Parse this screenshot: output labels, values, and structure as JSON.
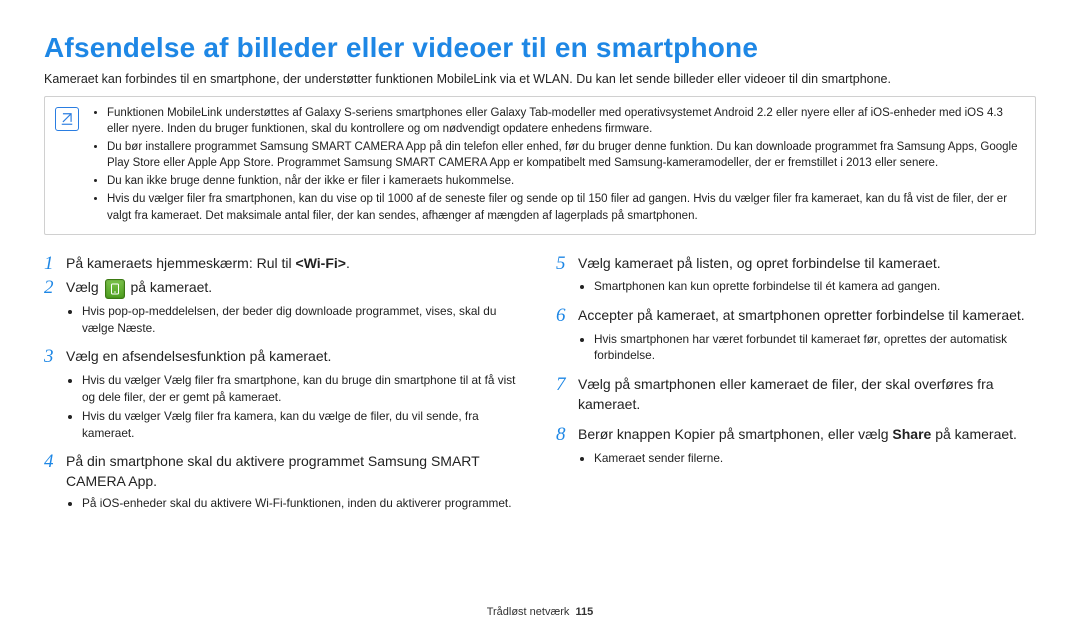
{
  "title": "Afsendelse af billeder eller videoer til en smartphone",
  "intro": "Kameraet kan forbindes til en smartphone, der understøtter funktionen MobileLink via et WLAN. Du kan let sende billeder eller videoer til din smartphone.",
  "note_icon_label": "note",
  "notes": [
    "Funktionen MobileLink understøttes af Galaxy S-seriens smartphones eller Galaxy Tab-modeller med operativsystemet Android 2.2 eller nyere eller af iOS-enheder med iOS 4.3 eller nyere. Inden du bruger funktionen, skal du kontrollere og om nødvendigt opdatere enhedens firmware.",
    "Du bør installere programmet Samsung SMART CAMERA App på din telefon eller enhed, før du bruger denne funktion. Du kan downloade programmet fra Samsung Apps, Google Play Store eller Apple App Store. Programmet Samsung SMART CAMERA App er kompatibelt med Samsung-kameramodeller, der er fremstillet i 2013 eller senere.",
    "Du kan ikke bruge denne funktion, når der ikke er filer i kameraets hukommelse.",
    "Hvis du vælger filer fra smartphonen, kan du vise op til 1000 af de seneste filer og sende op til 150 filer ad gangen. Hvis du vælger filer fra kameraet, kan du få vist de filer, der er valgt fra kameraet. Det maksimale antal filer, der kan sendes, afhænger af mængden af lagerplads på smartphonen."
  ],
  "steps_left": {
    "1": {
      "pre": "På kameraets hjemmeskærm: Rul til ",
      "bold": "<Wi-Fi>",
      "post": "."
    },
    "2": {
      "pre": "Vælg ",
      "post": " på kameraet.",
      "bullets": [
        {
          "pre": "Hvis pop-op-meddelelsen, der beder dig downloade programmet, vises, skal du vælge ",
          "bold": "Næste",
          "post": "."
        }
      ]
    },
    "3": {
      "text": "Vælg en afsendelsesfunktion på kameraet.",
      "bullets": [
        {
          "pre": "Hvis du vælger ",
          "bold": "Vælg filer fra smartphone",
          "post": ", kan du bruge din smartphone til at få vist og dele filer, der er gemt på kameraet."
        },
        {
          "pre": "Hvis du vælger ",
          "bold": "Vælg filer fra kamera",
          "post": ", kan du vælge de filer, du vil sende, fra kameraet."
        }
      ]
    },
    "4": {
      "text": "På din smartphone skal du aktivere programmet Samsung SMART CAMERA App.",
      "bullets": [
        {
          "text": "På iOS-enheder skal du aktivere Wi-Fi-funktionen, inden du aktiverer programmet."
        }
      ]
    }
  },
  "steps_right": {
    "5": {
      "text": "Vælg kameraet på listen, og opret forbindelse til kameraet.",
      "bullets": [
        {
          "text": "Smartphonen kan kun oprette forbindelse til ét kamera ad gangen."
        }
      ]
    },
    "6": {
      "text": "Accepter på kameraet, at smartphonen opretter forbindelse til kameraet.",
      "bullets": [
        {
          "text": "Hvis smartphonen har været forbundet til kameraet før, oprettes der automatisk forbindelse."
        }
      ]
    },
    "7": {
      "text": "Vælg på smartphonen eller kameraet de filer, der skal overføres fra kameraet."
    },
    "8": {
      "pre": "Berør knappen Kopier på smartphonen, eller vælg ",
      "bold": "Share",
      "post": " på kameraet.",
      "bullets": [
        {
          "text": "Kameraet sender filerne."
        }
      ]
    }
  },
  "footer_section": "Trådløst netværk",
  "footer_page": "115"
}
